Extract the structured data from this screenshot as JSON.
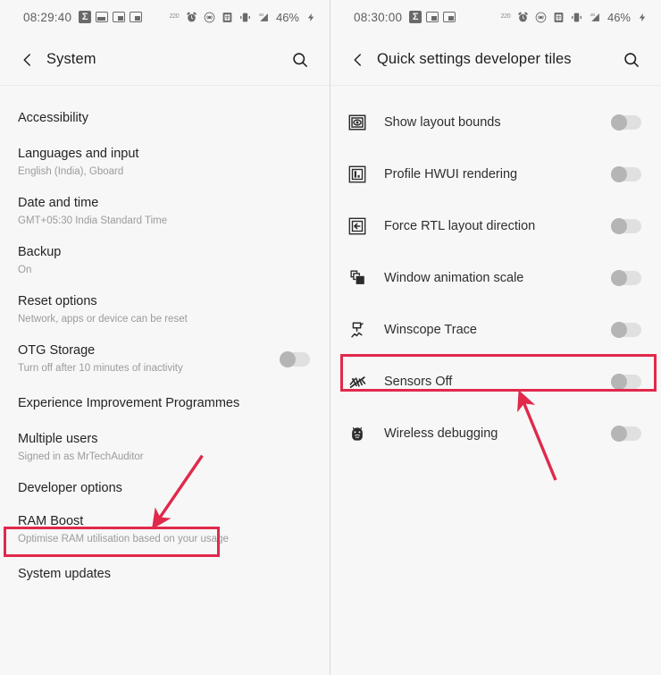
{
  "annotation": {
    "color": "#e0294b"
  },
  "left_panel": {
    "status_bar": {
      "time": "08:29:40",
      "battery": "46%",
      "left_icons": [
        "sigma-app-icon",
        "split-screen-icon",
        "window-pip-icon",
        "window-pip-icon"
      ],
      "right_icons": [
        "data-saver-220-icon",
        "alarm-icon",
        "hotspot-icon",
        "sim-icon",
        "vibrate-icon",
        "signal-4g-icon"
      ],
      "data_label": "220",
      "network_label": "4G"
    },
    "app_bar": {
      "title": "System",
      "back_icon": "chevron-left-icon",
      "search_icon": "search-icon"
    },
    "items": [
      {
        "title": "Accessibility",
        "sub": "",
        "toggle": false
      },
      {
        "title": "Languages and input",
        "sub": "English (India), Gboard",
        "toggle": false
      },
      {
        "title": "Date and time",
        "sub": "GMT+05:30 India Standard Time",
        "toggle": false
      },
      {
        "title": "Backup",
        "sub": "On",
        "toggle": false
      },
      {
        "title": "Reset options",
        "sub": "Network, apps or device can be reset",
        "toggle": false
      },
      {
        "title": "OTG Storage",
        "sub": "Turn off after 10 minutes of inactivity",
        "toggle": true
      },
      {
        "title": "Experience Improvement Programmes",
        "sub": "",
        "toggle": false
      },
      {
        "title": "Multiple users",
        "sub": "Signed in as MrTechAuditor",
        "toggle": false
      },
      {
        "title": "Developer options",
        "sub": "",
        "toggle": false
      },
      {
        "title": "RAM Boost",
        "sub": "Optimise RAM utilisation based on your usage",
        "toggle": false
      },
      {
        "title": "System updates",
        "sub": "",
        "toggle": false
      }
    ],
    "highlight_target": "Developer options"
  },
  "right_panel": {
    "status_bar": {
      "time": "08:30:00",
      "battery": "46%",
      "left_icons": [
        "sigma-app-icon",
        "window-pip-icon",
        "window-pip-icon"
      ],
      "right_icons": [
        "data-saver-220-icon",
        "alarm-icon",
        "hotspot-icon",
        "sim-icon",
        "vibrate-icon",
        "signal-4g-icon"
      ],
      "data_label": "220",
      "network_label": "4G"
    },
    "app_bar": {
      "title": "Quick settings developer tiles",
      "back_icon": "chevron-left-icon",
      "search_icon": "search-icon"
    },
    "tiles": [
      {
        "label": "Show layout bounds",
        "icon": "layout-bounds-icon",
        "toggle": false
      },
      {
        "label": "Profile HWUI rendering",
        "icon": "hwui-profile-icon",
        "toggle": false
      },
      {
        "label": "Force RTL layout direction",
        "icon": "rtl-arrow-icon",
        "toggle": false
      },
      {
        "label": "Window animation scale",
        "icon": "window-stack-icon",
        "toggle": false
      },
      {
        "label": "Winscope Trace",
        "icon": "winscope-trace-icon",
        "toggle": false
      },
      {
        "label": "Sensors Off",
        "icon": "sensors-off-icon",
        "toggle": false
      },
      {
        "label": "Wireless debugging",
        "icon": "android-bug-icon",
        "toggle": false
      }
    ],
    "highlight_target": "Sensors Off"
  }
}
